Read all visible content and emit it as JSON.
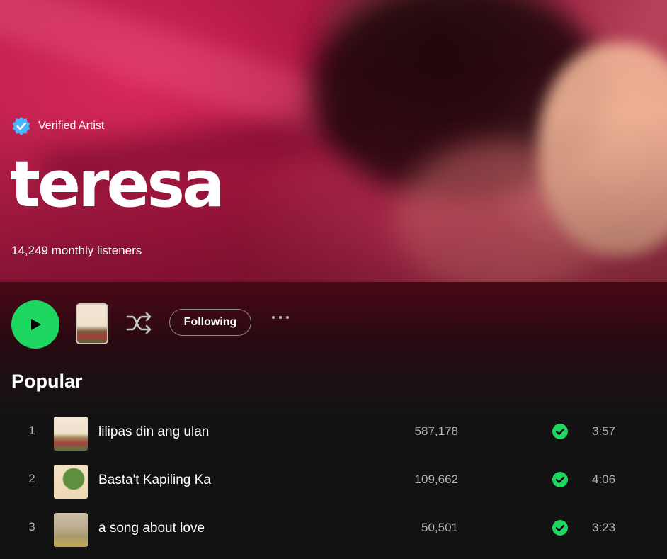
{
  "artist": {
    "verified_label": "Verified Artist",
    "name": "teresa",
    "monthly_listeners": "14,249 monthly listeners"
  },
  "controls": {
    "follow_label": "Following",
    "play_icon": "play-icon",
    "shuffle_icon": "shuffle-icon",
    "more_icon": "more-options-icon"
  },
  "popular": {
    "title": "Popular",
    "tracks": [
      {
        "rank": "1",
        "title": "lilipas din ang ulan",
        "plays": "587,178",
        "duration": "3:57"
      },
      {
        "rank": "2",
        "title": "Basta't Kapiling Ka",
        "plays": "109,662",
        "duration": "4:06"
      },
      {
        "rank": "3",
        "title": "a song about love",
        "plays": "50,501",
        "duration": "3:23"
      }
    ]
  },
  "colors": {
    "accent": "#1ed760",
    "verified": "#4cb3ff",
    "background": "#121212"
  }
}
